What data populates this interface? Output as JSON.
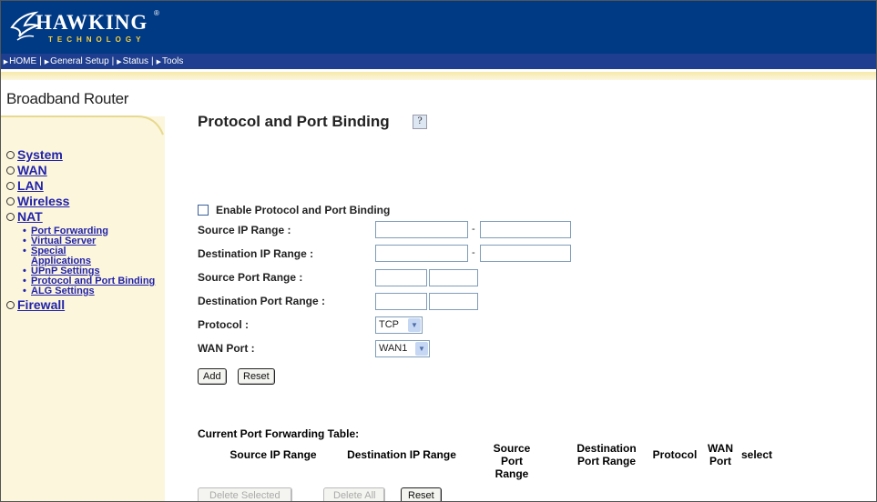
{
  "brand": {
    "name": "HAWKING",
    "sub": "TECHNOLOGY",
    "reg": "®"
  },
  "nav": [
    {
      "label": "HOME"
    },
    {
      "label": "General Setup"
    },
    {
      "label": "Status"
    },
    {
      "label": "Tools"
    }
  ],
  "sidebar": {
    "title": "Broadband Router",
    "items": [
      {
        "label": "System"
      },
      {
        "label": "WAN"
      },
      {
        "label": "LAN"
      },
      {
        "label": "Wireless"
      },
      {
        "label": "NAT"
      },
      {
        "label": "Firewall"
      }
    ],
    "nat_sub": [
      {
        "label": "Port Forwarding"
      },
      {
        "label": "Virtual Server"
      },
      {
        "label": "Special Applications"
      },
      {
        "label": "UPnP Settings"
      },
      {
        "label": "Protocol and Port Binding"
      },
      {
        "label": "ALG Settings"
      }
    ]
  },
  "page": {
    "title": "Protocol and Port Binding",
    "help_icon": "?"
  },
  "form": {
    "enable_label": "Enable Protocol and Port Binding",
    "enable_checked": false,
    "source_ip_label": "Source IP Range :",
    "dest_ip_label": "Destination IP Range :",
    "source_port_label": "Source Port Range :",
    "dest_port_label": "Destination Port Range :",
    "protocol_label": "Protocol :",
    "protocol_value": "TCP",
    "wan_port_label": "WAN Port :",
    "wan_port_value": "WAN1",
    "range_sep": "-",
    "add_label": "Add",
    "reset_label": "Reset"
  },
  "table": {
    "title": "Current Port Forwarding Table:",
    "headers": [
      "Source IP Range",
      "Destination IP Range",
      "Source Port Range",
      "Destination Port Range",
      "Protocol",
      "WAN Port",
      "select"
    ],
    "delete_selected_label": "Delete Selected",
    "delete_all_label": "Delete All",
    "reset_label": "Reset"
  },
  "colors": {
    "banner": "#003a84",
    "navbar": "#1f3e8f",
    "sidebar": "#fbf6dc",
    "link": "#2222aa"
  }
}
